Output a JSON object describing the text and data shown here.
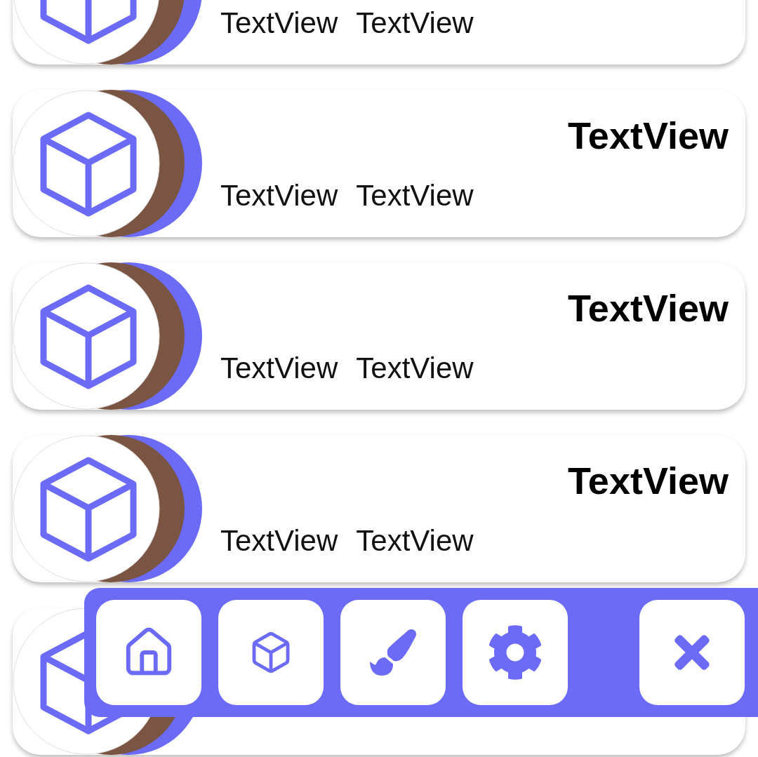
{
  "cards": [
    {
      "kind": "item",
      "subtitles": [
        "TextView",
        "TextView"
      ]
    },
    {
      "kind": "item",
      "title": "TextView",
      "subtitles": [
        "TextView",
        "TextView"
      ]
    },
    {
      "kind": "item",
      "title": "TextView",
      "subtitles": [
        "TextView",
        "TextView"
      ]
    },
    {
      "kind": "item",
      "title": "TextView",
      "subtitles": [
        "TextView",
        "TextView"
      ]
    },
    {
      "kind": "item"
    }
  ],
  "toolbar": {
    "buttons": [
      {
        "kind": "home"
      },
      {
        "kind": "cube"
      },
      {
        "kind": "brush"
      },
      {
        "kind": "gear"
      },
      {
        "kind": "close"
      }
    ]
  }
}
